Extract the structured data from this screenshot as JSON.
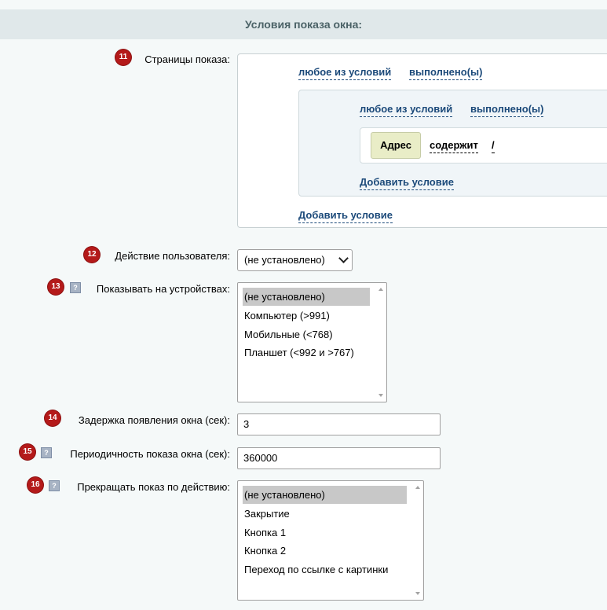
{
  "section_title": "Условия показа окна:",
  "rows": {
    "pages": {
      "badge": "11",
      "label": "Страницы показа:"
    },
    "user_action": {
      "badge": "12",
      "label": "Действие пользователя:"
    },
    "devices": {
      "badge": "13",
      "help": "?",
      "label": "Показывать на устройствах:"
    },
    "delay": {
      "badge": "14",
      "label": "Задержка появления окна (сек):"
    },
    "periodicity": {
      "badge": "15",
      "help": "?",
      "label": "Периодичность показа окна (сек):"
    },
    "stop_on": {
      "badge": "16",
      "help": "?",
      "label": "Прекращать показ по действию:"
    }
  },
  "conditions": {
    "outer": {
      "any_link": "любое из условий",
      "done_link": "выполнено(ы)",
      "add_link": "Добавить условие"
    },
    "inner": {
      "any_link": "любое из условий",
      "done_link": "выполнено(ы)",
      "add_link": "Добавить условие"
    },
    "condition": {
      "field": "Адрес",
      "operator": "содержит",
      "value": "/"
    }
  },
  "user_action_select": {
    "value": "(не установлено)"
  },
  "devices_list": {
    "options": [
      "(не установлено)",
      "Компьютер (>991)",
      "Мобильные (<768)",
      "Планшет (<992 и >767)"
    ],
    "selected": "(не установлено)"
  },
  "delay_input": {
    "value": "3"
  },
  "periodicity_input": {
    "value": "360000"
  },
  "stop_list": {
    "options": [
      "(не установлено)",
      "Закрытие",
      "Кнопка 1",
      "Кнопка 2",
      "Переход по ссылке с картинки"
    ],
    "selected": "(не установлено)"
  },
  "colors": {
    "badge": "#b41a1a",
    "link": "#1c4a7a",
    "header_bg": "#e0e8ea",
    "page_bg": "#f5f9f9"
  }
}
